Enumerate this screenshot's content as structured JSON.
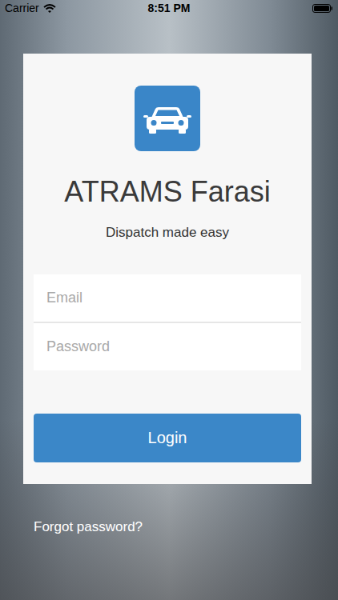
{
  "status_bar": {
    "carrier": "Carrier",
    "time": "8:51 PM"
  },
  "app": {
    "title": "ATRAMS Farasi",
    "subtitle": "Dispatch made easy"
  },
  "fields": [
    {
      "placeholder": "Email"
    },
    {
      "placeholder": "Password"
    }
  ],
  "login_button": {
    "label": "Login"
  },
  "forgot_link": "Forgot password?"
}
